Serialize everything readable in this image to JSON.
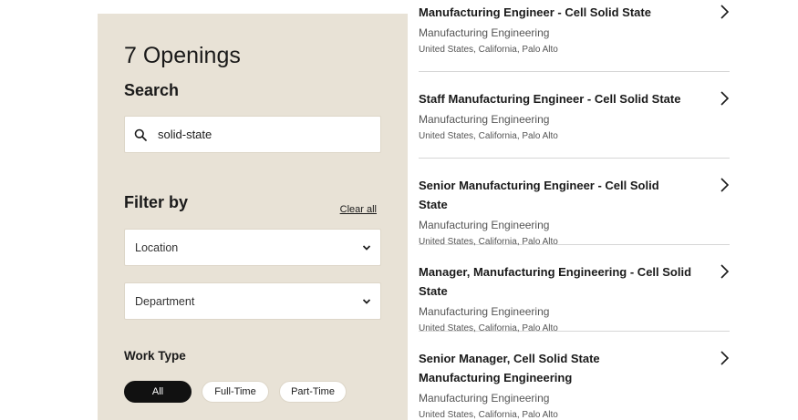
{
  "sidebar": {
    "openings": "7 Openings",
    "search_heading": "Search",
    "search_value": "solid-state",
    "filter_heading": "Filter by",
    "clear_all": "Clear all",
    "location_label": "Location",
    "department_label": "Department",
    "work_type_heading": "Work Type",
    "work_types": [
      "All",
      "Full-Time",
      "Part-Time"
    ]
  },
  "jobs": [
    {
      "title": "Manufacturing Engineer - Cell Solid State",
      "department": "Manufacturing Engineering",
      "location": "United States, California, Palo Alto"
    },
    {
      "title": "Staff Manufacturing Engineer - Cell Solid State",
      "department": "Manufacturing Engineering",
      "location": "United States, California, Palo Alto"
    },
    {
      "title": "Senior Manufacturing Engineer - Cell Solid State",
      "department": "Manufacturing Engineering",
      "location": "United States, California, Palo Alto"
    },
    {
      "title": "Manager, Manufacturing Engineering - Cell Solid State",
      "department": "Manufacturing Engineering",
      "location": "United States, California, Palo Alto"
    },
    {
      "title": "Senior Manager, Cell Solid State Manufacturing Engineering",
      "department": "Manufacturing Engineering",
      "location": "United States, California, Palo Alto"
    }
  ],
  "icons": {
    "search": "search-icon",
    "dropdown": "chevron-down-icon",
    "row_arrow": "chevron-right-icon"
  }
}
